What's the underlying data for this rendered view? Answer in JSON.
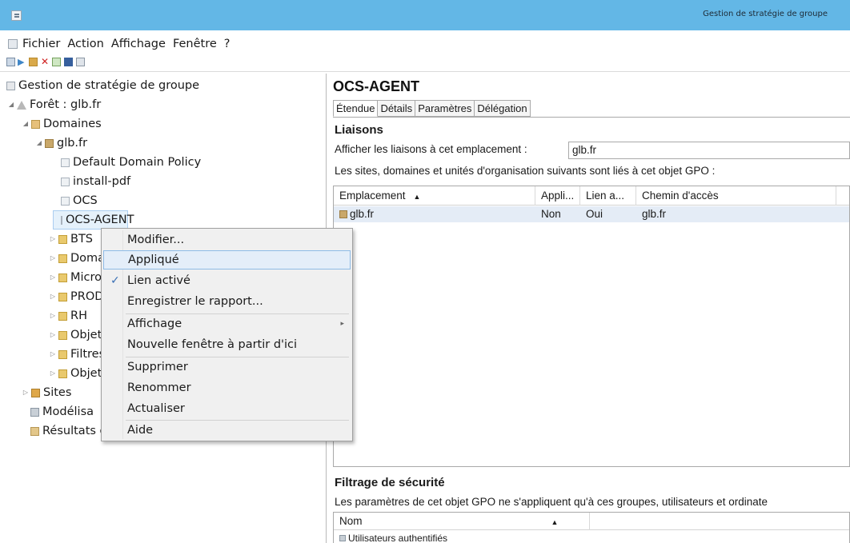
{
  "window": {
    "title": "Gestion de stratégie de groupe"
  },
  "menubar": {
    "items": [
      "Fichier",
      "Action",
      "Affichage",
      "Fenêtre",
      "?"
    ]
  },
  "toolbar": {
    "icons": [
      "back-arrow-icon",
      "forward-arrow-icon",
      "up-folder-icon",
      "show-hide-tree-icon",
      "delete-icon",
      "refresh-icon",
      "help-icon",
      "properties-icon"
    ]
  },
  "tree": {
    "root": "Gestion de stratégie de groupe",
    "forest": "Forêt : glb.fr",
    "domains": "Domaines",
    "domain": "glb.fr",
    "items": [
      "Default Domain Policy",
      "install-pdf",
      "OCS",
      "OCS-AGENT",
      "BTS",
      "Doma",
      "Micro",
      "PROD",
      "RH",
      "Objet",
      "Filtres",
      "Objet"
    ],
    "sites": "Sites",
    "modeling": "Modélisa",
    "results": "Résultats de stratégie de groupe"
  },
  "right": {
    "heading": "OCS-AGENT",
    "tabs": [
      "Étendue",
      "Détails",
      "Paramètres",
      "Délégation"
    ],
    "links": {
      "title": "Liaisons",
      "show_label": "Afficher les liaisons à cet emplacement :",
      "show_value": "glb.fr",
      "desc": "Les sites, domaines et unités d'organisation suivants sont liés à cet objet GPO :",
      "columns": [
        "Emplacement",
        "Appli...",
        "Lien a...",
        "Chemin d'accès"
      ],
      "rows": [
        {
          "location": "glb.fr",
          "applied": "Non",
          "link": "Oui",
          "path": "glb.fr"
        }
      ]
    },
    "security": {
      "title": "Filtrage de sécurité",
      "desc": "Les paramètres de cet objet GPO ne s'appliquent qu'à ces groupes, utilisateurs et ordinate",
      "columns": [
        "Nom"
      ],
      "rows": [
        "Utilisateurs authentifiés"
      ]
    }
  },
  "context_menu": {
    "items": {
      "modify": "Modifier...",
      "applied": "Appliqué",
      "link_enabled": "Lien activé",
      "save_report": "Enregistrer le rapport...",
      "view": "Affichage",
      "new_window": "Nouvelle fenêtre à partir d'ici",
      "delete": "Supprimer",
      "rename": "Renommer",
      "refresh": "Actualiser",
      "help": "Aide"
    },
    "checked": "link_enabled",
    "highlighted": "applied"
  }
}
